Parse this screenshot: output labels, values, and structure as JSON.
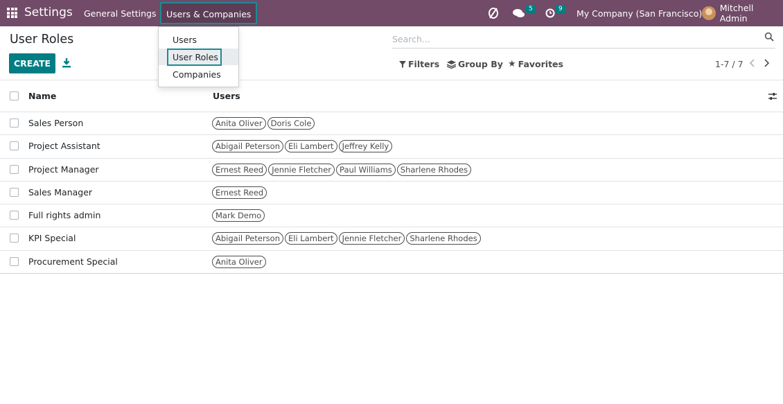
{
  "navbar": {
    "brand": "Settings",
    "menus": [
      "General Settings",
      "Users & Companies"
    ],
    "chat_count": "5",
    "activity_count": "9",
    "company": "My Company (San Francisco)",
    "user": "Mitchell Admin",
    "accent": "#714B67"
  },
  "dropdown": {
    "items": [
      "Users",
      "User Roles",
      "Companies"
    ],
    "active": "User Roles"
  },
  "control_panel": {
    "title": "User Roles",
    "create_label": "CREATE",
    "search_placeholder": "Search...",
    "filters_label": "Filters",
    "group_by_label": "Group By",
    "favorites_label": "Favorites",
    "pager": "1-7 / 7",
    "primary_color": "#017e84"
  },
  "table": {
    "columns": [
      "Name",
      "Users"
    ],
    "rows": [
      {
        "name": "Sales Person",
        "users": [
          "Anita Oliver",
          "Doris Cole"
        ]
      },
      {
        "name": "Project Assistant",
        "users": [
          "Abigail Peterson",
          "Eli Lambert",
          "Jeffrey Kelly"
        ]
      },
      {
        "name": "Project Manager",
        "users": [
          "Ernest Reed",
          "Jennie Fletcher",
          "Paul Williams",
          "Sharlene Rhodes"
        ]
      },
      {
        "name": "Sales Manager",
        "users": [
          "Ernest Reed"
        ]
      },
      {
        "name": "Full rights admin",
        "users": [
          "Mark Demo"
        ]
      },
      {
        "name": "KPI Special",
        "users": [
          "Abigail Peterson",
          "Eli Lambert",
          "Jennie Fletcher",
          "Sharlene Rhodes"
        ]
      },
      {
        "name": "Procurement Special",
        "users": [
          "Anita Oliver"
        ]
      }
    ]
  }
}
